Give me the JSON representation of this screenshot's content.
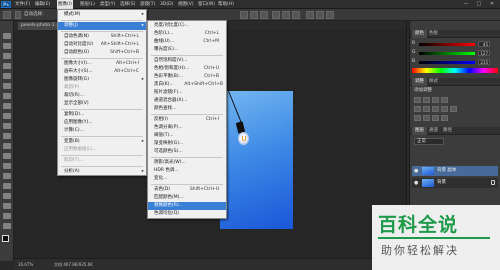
{
  "app": {
    "logo": "Ps"
  },
  "menubar": {
    "items": [
      "文件(F)",
      "编辑(E)",
      "图像(I)",
      "图层(L)",
      "类型(Y)",
      "选择(S)",
      "滤镜(T)",
      "3D(D)",
      "视图(V)",
      "窗口(W)",
      "帮助(H)"
    ],
    "window_controls": [
      "—",
      "□",
      "✕"
    ]
  },
  "options_bar": {
    "label": "自动选择："
  },
  "document_tab": {
    "title": "pexels-photo-1..."
  },
  "image_menu": {
    "items": [
      {
        "label": "模式(M)",
        "shortcut": "",
        "submenu": true,
        "disabled": false
      },
      {
        "label": "调整(J)",
        "shortcut": "",
        "submenu": true,
        "disabled": false,
        "highlighted": true
      },
      {
        "label": "自动色调(N)",
        "shortcut": "Shift+Ctrl+L",
        "disabled": false
      },
      {
        "label": "自动对比度(U)",
        "shortcut": "Alt+Shift+Ctrl+L",
        "disabled": false
      },
      {
        "label": "自动颜色(O)",
        "shortcut": "Shift+Ctrl+B",
        "disabled": false
      },
      {
        "label": "图像大小(I)...",
        "shortcut": "Alt+Ctrl+I",
        "disabled": false
      },
      {
        "label": "画布大小(S)...",
        "shortcut": "Alt+Ctrl+C",
        "disabled": false
      },
      {
        "label": "图像旋转(G)",
        "shortcut": "",
        "submenu": true,
        "disabled": false
      },
      {
        "label": "裁剪(P)",
        "shortcut": "",
        "disabled": true
      },
      {
        "label": "裁切(R)...",
        "shortcut": "",
        "disabled": false
      },
      {
        "label": "显示全部(V)",
        "shortcut": "",
        "disabled": false
      },
      {
        "label": "复制(D)...",
        "shortcut": "",
        "disabled": false
      },
      {
        "label": "应用图像(Y)...",
        "shortcut": "",
        "disabled": false
      },
      {
        "label": "计算(C)...",
        "shortcut": "",
        "disabled": false
      },
      {
        "label": "变量(B)",
        "shortcut": "",
        "submenu": true,
        "disabled": false
      },
      {
        "label": "应用数据组(L)...",
        "shortcut": "",
        "disabled": true
      },
      {
        "label": "陷印(T)...",
        "shortcut": "",
        "disabled": true
      },
      {
        "label": "分析(A)",
        "shortcut": "",
        "submenu": true,
        "disabled": false
      }
    ]
  },
  "adjust_submenu": {
    "items": [
      {
        "label": "亮度/对比度(C)...",
        "shortcut": ""
      },
      {
        "label": "色阶(L)...",
        "shortcut": "Ctrl+L"
      },
      {
        "label": "曲线(U)...",
        "shortcut": "Ctrl+M"
      },
      {
        "label": "曝光度(E)...",
        "shortcut": ""
      },
      {
        "label": "自然饱和度(V)...",
        "shortcut": ""
      },
      {
        "label": "色相/饱和度(H)...",
        "shortcut": "Ctrl+U"
      },
      {
        "label": "色彩平衡(B)...",
        "shortcut": "Ctrl+B"
      },
      {
        "label": "黑白(K)...",
        "shortcut": "Alt+Shift+Ctrl+B"
      },
      {
        "label": "照片滤镜(F)...",
        "shortcut": ""
      },
      {
        "label": "通道混合器(X)...",
        "shortcut": ""
      },
      {
        "label": "颜色查找...",
        "shortcut": ""
      },
      {
        "label": "反相(I)",
        "shortcut": "Ctrl+I"
      },
      {
        "label": "色调分离(P)...",
        "shortcut": ""
      },
      {
        "label": "阈值(T)...",
        "shortcut": ""
      },
      {
        "label": "渐变映射(G)...",
        "shortcut": ""
      },
      {
        "label": "可选颜色(S)...",
        "shortcut": ""
      },
      {
        "label": "阴影/高光(W)...",
        "shortcut": ""
      },
      {
        "label": "HDR 色调...",
        "shortcut": ""
      },
      {
        "label": "变化...",
        "shortcut": ""
      },
      {
        "label": "去色(D)",
        "shortcut": "Shift+Ctrl+U"
      },
      {
        "label": "匹配颜色(M)...",
        "shortcut": ""
      },
      {
        "label": "替换颜色(R)...",
        "shortcut": "",
        "highlighted": true
      },
      {
        "label": "色调均化(Q)",
        "shortcut": ""
      }
    ]
  },
  "color_panel": {
    "tabs": [
      "颜色",
      "色板"
    ],
    "channels": [
      {
        "letter": "R",
        "value": "45",
        "gradient": "linear-gradient(90deg,#000,#f00)"
      },
      {
        "letter": "G",
        "value": "127",
        "gradient": "linear-gradient(90deg,#000,#0f0)"
      },
      {
        "letter": "B",
        "value": "215",
        "gradient": "linear-gradient(90deg,#000,#00f)"
      }
    ]
  },
  "adjustments_panel": {
    "tabs": [
      "调整",
      "样式"
    ],
    "title": "添加调整"
  },
  "layers_panel": {
    "tabs": [
      "图层",
      "通道",
      "路径"
    ],
    "blend_mode": "正常",
    "layer_name": "背景 副本",
    "background_name": "背景"
  },
  "status": {
    "zoom": "16.67%",
    "doc_info": "文档:467.8K/935.6K"
  },
  "watermark": {
    "title": "百科全说",
    "subtitle": "助你轻松解决"
  }
}
